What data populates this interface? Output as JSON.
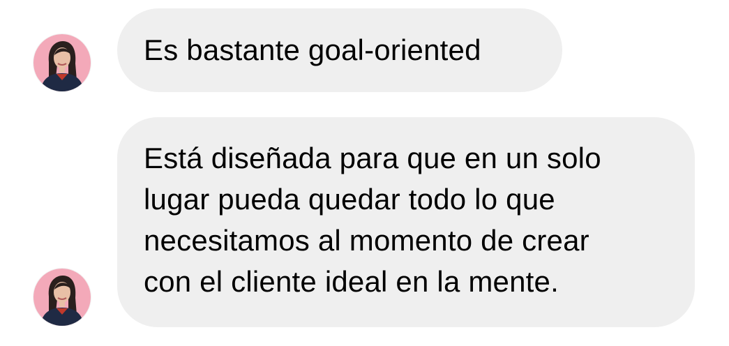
{
  "conversation": {
    "messages": [
      {
        "sender_avatar": "woman-portrait-avatar",
        "lines": [
          "Es bastante goal-oriented"
        ]
      },
      {
        "sender_avatar": "woman-portrait-avatar",
        "lines": [
          "Está diseñada para que en un solo",
          "lugar pueda quedar todo lo que",
          "necesitamos al momento de crear",
          "con el cliente ideal en la mente."
        ]
      }
    ]
  },
  "colors": {
    "bubble_background": "#efefef",
    "text": "#000000",
    "avatar_background": "#f3a9b9"
  }
}
